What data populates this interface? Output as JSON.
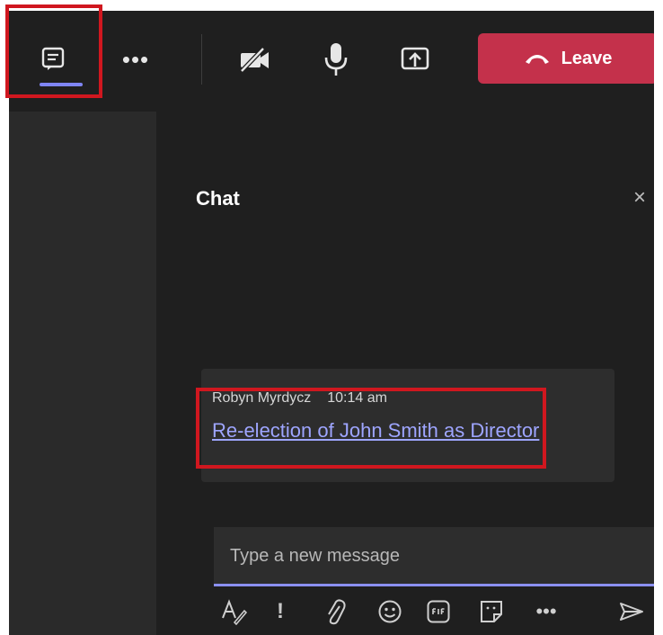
{
  "toolbar": {
    "chat_icon": "chat-icon",
    "more_label": "•••",
    "camera_icon": "camera-off-icon",
    "mic_icon": "microphone-icon",
    "share_icon": "share-screen-icon",
    "leave_label": "Leave",
    "leave_color": "#c4314b"
  },
  "chat": {
    "title": "Chat",
    "close_label": "×",
    "message": {
      "sender": "Robyn Myrdycz",
      "time": "10:14 am",
      "link_text": "Re-election of John Smith as Director"
    },
    "compose": {
      "placeholder": "Type a new message",
      "more_label": "•••",
      "important_label": "!"
    }
  },
  "colors": {
    "accent": "#7f85f5",
    "highlight": "#d0171f",
    "link": "#9ea5ff"
  }
}
